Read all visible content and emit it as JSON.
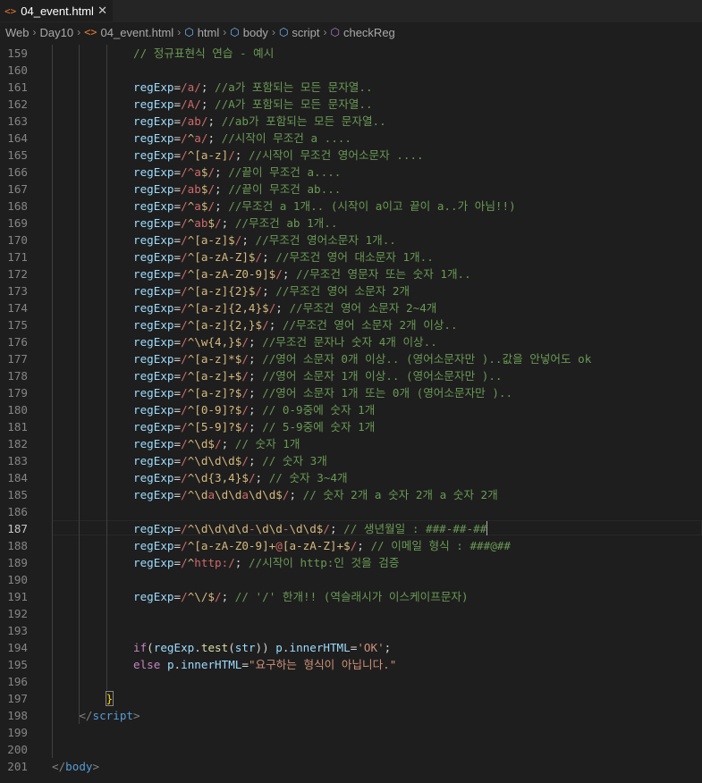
{
  "tab": {
    "icon": "<>",
    "title": "04_event.html",
    "close": "✕"
  },
  "breadcrumb": [
    "Web",
    "Day10",
    "04_event.html",
    "html",
    "body",
    "script",
    "checkReg"
  ],
  "active_line": 187,
  "lines": [
    {
      "n": 159,
      "indent": 3,
      "toks": [
        [
          "c",
          "// 정규표현식 연습 - 예시"
        ]
      ]
    },
    {
      "n": 160,
      "indent": 3,
      "toks": []
    },
    {
      "n": 161,
      "indent": 3,
      "toks": [
        [
          "v",
          "regExp"
        ],
        [
          "o",
          "="
        ],
        [
          "r",
          "/a/"
        ],
        [
          "o",
          "; "
        ],
        [
          "c",
          "//a가 포함되는 모든 문자열.."
        ]
      ]
    },
    {
      "n": 162,
      "indent": 3,
      "toks": [
        [
          "v",
          "regExp"
        ],
        [
          "o",
          "="
        ],
        [
          "r",
          "/A/"
        ],
        [
          "o",
          "; "
        ],
        [
          "c",
          "//A가 포함되는 모든 문자열.."
        ]
      ]
    },
    {
      "n": 163,
      "indent": 3,
      "toks": [
        [
          "v",
          "regExp"
        ],
        [
          "o",
          "="
        ],
        [
          "r",
          "/ab/"
        ],
        [
          "o",
          "; "
        ],
        [
          "c",
          "//ab가 포함되는 모든 문자열.."
        ]
      ]
    },
    {
      "n": 164,
      "indent": 3,
      "toks": [
        [
          "v",
          "regExp"
        ],
        [
          "o",
          "="
        ],
        [
          "r",
          "/"
        ],
        [
          "b",
          "^"
        ],
        [
          "r",
          "a/"
        ],
        [
          "o",
          "; "
        ],
        [
          "c",
          "//시작이 무조건 a ...."
        ]
      ]
    },
    {
      "n": 165,
      "indent": 3,
      "toks": [
        [
          "v",
          "regExp"
        ],
        [
          "o",
          "="
        ],
        [
          "r",
          "/"
        ],
        [
          "b",
          "^[a-z]"
        ],
        [
          "r",
          "/"
        ],
        [
          "o",
          "; "
        ],
        [
          "c",
          "//시작이 무조건 영어소문자 ...."
        ]
      ]
    },
    {
      "n": 166,
      "indent": 3,
      "toks": [
        [
          "v",
          "regExp"
        ],
        [
          "o",
          "="
        ],
        [
          "r",
          "/^a"
        ],
        [
          "b",
          "$"
        ],
        [
          "r",
          "/"
        ],
        [
          "o",
          "; "
        ],
        [
          "c",
          "//끝이 무조건 a...."
        ]
      ]
    },
    {
      "n": 167,
      "indent": 3,
      "toks": [
        [
          "v",
          "regExp"
        ],
        [
          "o",
          "="
        ],
        [
          "r",
          "/ab"
        ],
        [
          "b",
          "$"
        ],
        [
          "r",
          "/"
        ],
        [
          "o",
          "; "
        ],
        [
          "c",
          "//끝이 무조건 ab..."
        ]
      ]
    },
    {
      "n": 168,
      "indent": 3,
      "toks": [
        [
          "v",
          "regExp"
        ],
        [
          "o",
          "="
        ],
        [
          "r",
          "/"
        ],
        [
          "b",
          "^"
        ],
        [
          "r",
          "a"
        ],
        [
          "b",
          "$"
        ],
        [
          "r",
          "/"
        ],
        [
          "o",
          "; "
        ],
        [
          "c",
          "//무조건 a 1개.. (시작이 a이고 끝이 a..가 아님!!)"
        ]
      ]
    },
    {
      "n": 169,
      "indent": 3,
      "toks": [
        [
          "v",
          "regExp"
        ],
        [
          "o",
          "="
        ],
        [
          "r",
          "/"
        ],
        [
          "b",
          "^"
        ],
        [
          "r",
          "ab"
        ],
        [
          "b",
          "$"
        ],
        [
          "r",
          "/"
        ],
        [
          "o",
          "; "
        ],
        [
          "c",
          "//무조건 ab 1개.."
        ]
      ]
    },
    {
      "n": 170,
      "indent": 3,
      "toks": [
        [
          "v",
          "regExp"
        ],
        [
          "o",
          "="
        ],
        [
          "r",
          "/"
        ],
        [
          "b",
          "^[a-z]$"
        ],
        [
          "r",
          "/"
        ],
        [
          "o",
          "; "
        ],
        [
          "c",
          "//무조건 영어소문자 1개.."
        ]
      ]
    },
    {
      "n": 171,
      "indent": 3,
      "toks": [
        [
          "v",
          "regExp"
        ],
        [
          "o",
          "="
        ],
        [
          "r",
          "/"
        ],
        [
          "b",
          "^[a-zA-Z]$"
        ],
        [
          "r",
          "/"
        ],
        [
          "o",
          "; "
        ],
        [
          "c",
          "//무조건 영어 대소문자 1개.."
        ]
      ]
    },
    {
      "n": 172,
      "indent": 3,
      "toks": [
        [
          "v",
          "regExp"
        ],
        [
          "o",
          "="
        ],
        [
          "r",
          "/"
        ],
        [
          "b",
          "^[a-zA-Z0-9]$"
        ],
        [
          "r",
          "/"
        ],
        [
          "o",
          "; "
        ],
        [
          "c",
          "//무조건 영문자 또는 숫자 1개.."
        ]
      ]
    },
    {
      "n": 173,
      "indent": 3,
      "toks": [
        [
          "v",
          "regExp"
        ],
        [
          "o",
          "="
        ],
        [
          "r",
          "/"
        ],
        [
          "b",
          "^[a-z]{2}$"
        ],
        [
          "r",
          "/"
        ],
        [
          "o",
          "; "
        ],
        [
          "c",
          "//무조건 영어 소문자 2개"
        ]
      ]
    },
    {
      "n": 174,
      "indent": 3,
      "toks": [
        [
          "v",
          "regExp"
        ],
        [
          "o",
          "="
        ],
        [
          "r",
          "/"
        ],
        [
          "b",
          "^[a-z]{2,4}$"
        ],
        [
          "r",
          "/"
        ],
        [
          "o",
          "; "
        ],
        [
          "c",
          "//무조건 영어 소문자 2~4개"
        ]
      ]
    },
    {
      "n": 175,
      "indent": 3,
      "toks": [
        [
          "v",
          "regExp"
        ],
        [
          "o",
          "="
        ],
        [
          "r",
          "/"
        ],
        [
          "b",
          "^[a-z]{2,}$"
        ],
        [
          "r",
          "/"
        ],
        [
          "o",
          "; "
        ],
        [
          "c",
          "//무조건 영어 소문자 2개 이상.."
        ]
      ]
    },
    {
      "n": 176,
      "indent": 3,
      "toks": [
        [
          "v",
          "regExp"
        ],
        [
          "o",
          "="
        ],
        [
          "r",
          "/"
        ],
        [
          "b",
          "^\\w{4,}$"
        ],
        [
          "r",
          "/"
        ],
        [
          "o",
          "; "
        ],
        [
          "c",
          "//무조건 문자나 숫자 4개 이상.."
        ]
      ]
    },
    {
      "n": 177,
      "indent": 3,
      "toks": [
        [
          "v",
          "regExp"
        ],
        [
          "o",
          "="
        ],
        [
          "r",
          "/"
        ],
        [
          "b",
          "^[a-z]*$"
        ],
        [
          "r",
          "/"
        ],
        [
          "o",
          "; "
        ],
        [
          "c",
          "//영어 소문자 0개 이상.. (영어소문자만 )..값을 안넣어도 ok"
        ]
      ]
    },
    {
      "n": 178,
      "indent": 3,
      "toks": [
        [
          "v",
          "regExp"
        ],
        [
          "o",
          "="
        ],
        [
          "r",
          "/"
        ],
        [
          "b",
          "^[a-z]+$"
        ],
        [
          "r",
          "/"
        ],
        [
          "o",
          "; "
        ],
        [
          "c",
          "//영어 소문자 1개 이상.. (영어소문자만 ).."
        ]
      ]
    },
    {
      "n": 179,
      "indent": 3,
      "toks": [
        [
          "v",
          "regExp"
        ],
        [
          "o",
          "="
        ],
        [
          "r",
          "/"
        ],
        [
          "b",
          "^[a-z]?$"
        ],
        [
          "r",
          "/"
        ],
        [
          "o",
          "; "
        ],
        [
          "c",
          "//영어 소문자 1개 또는 0개 (영어소문자만 ).."
        ]
      ]
    },
    {
      "n": 180,
      "indent": 3,
      "toks": [
        [
          "v",
          "regExp"
        ],
        [
          "o",
          "="
        ],
        [
          "r",
          "/"
        ],
        [
          "b",
          "^[0-9]?$"
        ],
        [
          "r",
          "/"
        ],
        [
          "o",
          "; "
        ],
        [
          "c",
          "// 0-9중에 숫자 1개"
        ]
      ]
    },
    {
      "n": 181,
      "indent": 3,
      "toks": [
        [
          "v",
          "regExp"
        ],
        [
          "o",
          "="
        ],
        [
          "r",
          "/"
        ],
        [
          "b",
          "^[5-9]?$"
        ],
        [
          "r",
          "/"
        ],
        [
          "o",
          "; "
        ],
        [
          "c",
          "// 5-9중에 숫자 1개"
        ]
      ]
    },
    {
      "n": 182,
      "indent": 3,
      "toks": [
        [
          "v",
          "regExp"
        ],
        [
          "o",
          "="
        ],
        [
          "r",
          "/"
        ],
        [
          "b",
          "^\\d$"
        ],
        [
          "r",
          "/"
        ],
        [
          "o",
          "; "
        ],
        [
          "c",
          "// 숫자 1개"
        ]
      ]
    },
    {
      "n": 183,
      "indent": 3,
      "toks": [
        [
          "v",
          "regExp"
        ],
        [
          "o",
          "="
        ],
        [
          "r",
          "/"
        ],
        [
          "b",
          "^\\d\\d\\d$"
        ],
        [
          "r",
          "/"
        ],
        [
          "o",
          "; "
        ],
        [
          "c",
          "// 숫자 3개"
        ]
      ]
    },
    {
      "n": 184,
      "indent": 3,
      "toks": [
        [
          "v",
          "regExp"
        ],
        [
          "o",
          "="
        ],
        [
          "r",
          "/"
        ],
        [
          "b",
          "^\\d{3,4}$"
        ],
        [
          "r",
          "/"
        ],
        [
          "o",
          "; "
        ],
        [
          "c",
          "// 숫자 3~4개"
        ]
      ]
    },
    {
      "n": 185,
      "indent": 3,
      "toks": [
        [
          "v",
          "regExp"
        ],
        [
          "o",
          "="
        ],
        [
          "r",
          "/"
        ],
        [
          "b",
          "^\\d"
        ],
        [
          "r",
          "a"
        ],
        [
          "b",
          "\\d\\d"
        ],
        [
          "r",
          "a"
        ],
        [
          "b",
          "\\d\\d$"
        ],
        [
          "r",
          "/"
        ],
        [
          "o",
          "; "
        ],
        [
          "c",
          "// 숫자 2개 a 숫자 2개 a 숫자 2개"
        ]
      ]
    },
    {
      "n": 186,
      "indent": 3,
      "toks": []
    },
    {
      "n": 187,
      "indent": 3,
      "toks": [
        [
          "v",
          "regExp"
        ],
        [
          "o",
          "="
        ],
        [
          "r",
          "/"
        ],
        [
          "b",
          "^\\d\\d\\d\\d"
        ],
        [
          "r",
          "-"
        ],
        [
          "b",
          "\\d\\d"
        ],
        [
          "r",
          "-"
        ],
        [
          "b",
          "\\d\\d$"
        ],
        [
          "r",
          "/"
        ],
        [
          "o",
          "; "
        ],
        [
          "c",
          "// 생년월일 : ###-##-##"
        ],
        [
          "caret",
          ""
        ]
      ]
    },
    {
      "n": 188,
      "indent": 3,
      "toks": [
        [
          "v",
          "regExp"
        ],
        [
          "o",
          "="
        ],
        [
          "r",
          "/"
        ],
        [
          "b",
          "^[a-zA-Z0-9]+"
        ],
        [
          "r",
          "@"
        ],
        [
          "b",
          "[a-zA-Z]+$"
        ],
        [
          "r",
          "/"
        ],
        [
          "o",
          "; "
        ],
        [
          "c",
          "// 이메일 형식 : ###@##"
        ]
      ]
    },
    {
      "n": 189,
      "indent": 3,
      "toks": [
        [
          "v",
          "regExp"
        ],
        [
          "o",
          "="
        ],
        [
          "r",
          "/"
        ],
        [
          "b",
          "^"
        ],
        [
          "r",
          "http:/"
        ],
        [
          "o",
          "; "
        ],
        [
          "c",
          "//시작이 http:인 것을 검증"
        ]
      ]
    },
    {
      "n": 190,
      "indent": 3,
      "toks": []
    },
    {
      "n": 191,
      "indent": 3,
      "toks": [
        [
          "v",
          "regExp"
        ],
        [
          "o",
          "="
        ],
        [
          "r",
          "/"
        ],
        [
          "b",
          "^\\/$"
        ],
        [
          "r",
          "/"
        ],
        [
          "o",
          "; "
        ],
        [
          "c",
          "// '/' 한개!! (역슬래시가 이스케이프문자)"
        ]
      ]
    },
    {
      "n": 192,
      "indent": 3,
      "toks": []
    },
    {
      "n": 193,
      "indent": 3,
      "toks": []
    },
    {
      "n": 194,
      "indent": 3,
      "toks": [
        [
          "k",
          "if"
        ],
        [
          "o",
          "("
        ],
        [
          "v",
          "regExp"
        ],
        [
          "o",
          "."
        ],
        [
          "f",
          "test"
        ],
        [
          "o",
          "("
        ],
        [
          "v",
          "str"
        ],
        [
          "o",
          ")) "
        ],
        [
          "v",
          "p"
        ],
        [
          "o",
          "."
        ],
        [
          "v",
          "innerHTML"
        ],
        [
          "o",
          "="
        ],
        [
          "s",
          "'OK'"
        ],
        [
          "o",
          ";"
        ]
      ]
    },
    {
      "n": 195,
      "indent": 3,
      "toks": [
        [
          "k",
          "else"
        ],
        [
          "o",
          " "
        ],
        [
          "v",
          "p"
        ],
        [
          "o",
          "."
        ],
        [
          "v",
          "innerHTML"
        ],
        [
          "o",
          "="
        ],
        [
          "s",
          "\"요구하는 형식이 아닙니다.\""
        ]
      ]
    },
    {
      "n": 196,
      "indent": 3,
      "toks": []
    },
    {
      "n": 197,
      "indent": 2,
      "toks": [
        [
          "brk",
          "}"
        ]
      ]
    },
    {
      "n": 198,
      "indent": 1,
      "toks": [
        [
          "t1",
          "</"
        ],
        [
          "tg",
          "script"
        ],
        [
          "t1",
          ">"
        ]
      ]
    },
    {
      "n": 199,
      "indent": 1,
      "toks": []
    },
    {
      "n": 200,
      "indent": 1,
      "toks": []
    },
    {
      "n": 201,
      "indent": 0,
      "toks": [
        [
          "t1",
          "</"
        ],
        [
          "tg",
          "body"
        ],
        [
          "t1",
          ">"
        ]
      ]
    }
  ],
  "colors": {
    "background": "#1e1e1e",
    "variable": "#9cdcfe",
    "regex": "#d16969",
    "regex_special": "#d7ba7d",
    "comment": "#6a9955",
    "string": "#ce9178",
    "keyword": "#c586c0",
    "function": "#dcdcaa",
    "tag": "#569cd6"
  }
}
